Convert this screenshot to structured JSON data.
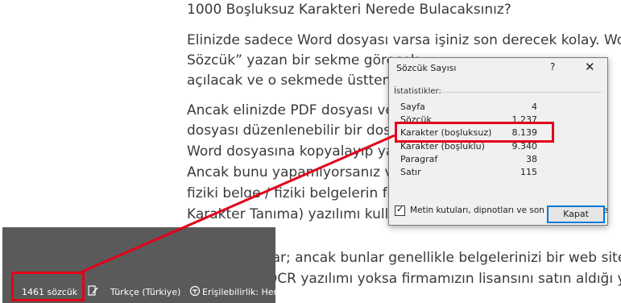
{
  "document": {
    "lines": [
      "1000 Boşluksuz Karakteri Nerede Bulacaksınız?",
      "Elinizde sadece Word dosyası varsa işiniz son derecek kolay. Word’u ac",
      "Sözcük” yazan bir sekme görecek",
      "açılacak ve o sekmede üstten üçü",
      "Ancak elinizde PDF dosyası veya",
      "dosyası düzenlenebilir bir dosya",
      "Word dosyasına kopyalayıp yapa",
      "Ancak bunu yapamıyorsanız ve e",
      "fiziki belge / fiziki belgelerin foto",
      "Karakter Tanıma) yazılımı kullanı",
      "planları da var; ancak bunlar genellikle belgelerinizi bir web sitesine yü",
      "elinizde bir OCR yazılımı yoksa firmamızın lisansını satın aldığı yazılımla"
    ]
  },
  "status_bar": {
    "word_count": "1461 sözcük",
    "language": "Türkçe (Türkiye)",
    "accessibility": "Erişilebilirlik: Her"
  },
  "dialog": {
    "title": "Sözcük Sayısı",
    "help": "?",
    "close": "✕",
    "group_label": "İstatistikler:",
    "stats": [
      {
        "label": "Sayfa",
        "value": "4"
      },
      {
        "label": "Sözcük",
        "value": "1.237"
      },
      {
        "label": "Karakter (boşluksuz)",
        "value": "8.139"
      },
      {
        "label": "Karakter (boşluklu)",
        "value": "9.340"
      },
      {
        "label": "Paragraf",
        "value": "38"
      },
      {
        "label": "Satır",
        "value": "115"
      }
    ],
    "checkbox_label": "Metin kutuları, dipnotları ve son notları da ekle",
    "close_button": "Kapat"
  },
  "colors": {
    "highlight": "#e2001a",
    "status_bar": "#5a5a5a",
    "dialog_bg": "#f0f0f0",
    "button_focus": "#0078d7"
  }
}
